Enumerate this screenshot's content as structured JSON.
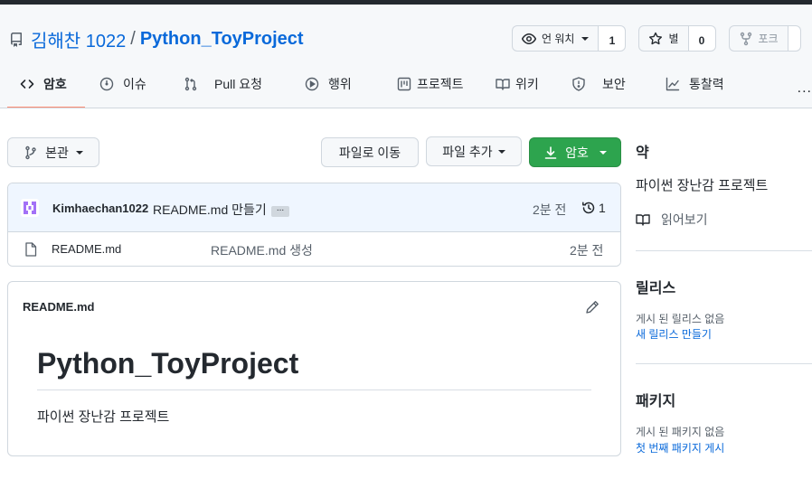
{
  "repo": {
    "owner": "김해찬 1022",
    "separator": "/",
    "name": "Python_ToyProject"
  },
  "actions": {
    "watch": {
      "label": "언 워치",
      "count": "1"
    },
    "star": {
      "label": "별",
      "count": "0"
    },
    "fork": {
      "label": "포크"
    }
  },
  "tabs": [
    {
      "label": "암호",
      "icon": "code-icon"
    },
    {
      "label": "이슈",
      "icon": "issue-icon"
    },
    {
      "label": "Pull 요청",
      "icon": "pull-request-icon"
    },
    {
      "label": "행위",
      "icon": "play-icon"
    },
    {
      "label": "프로젝트",
      "icon": "project-icon"
    },
    {
      "label": "위키",
      "icon": "book-icon"
    },
    {
      "label": "보안",
      "icon": "shield-icon"
    },
    {
      "label": "통찰력",
      "icon": "graph-icon"
    }
  ],
  "more_label": "...",
  "toolbar": {
    "branch_label": "본관",
    "goto_file_label": "파일로 이동",
    "add_file_label": "파일 추가",
    "code_label": "암호"
  },
  "commit": {
    "author": "Kimhaechan1022",
    "message": "README.md 만들기",
    "ellipsis": "...",
    "time": "2분 전",
    "history_count": "1"
  },
  "files": [
    {
      "name": "README.md",
      "message": "README.md 생성",
      "time": "2분 전"
    }
  ],
  "readme": {
    "header": "README.md",
    "title": "Python_ToyProject",
    "body": "파이썬 장난감 프로젝트"
  },
  "sidebar": {
    "about_title": "약",
    "description": "파이썬 장난감 프로젝트",
    "readme_link": "읽어보기",
    "releases_title": "릴리스",
    "releases_empty": "게시 된 릴리스 없음",
    "releases_create": "새 릴리스 만들기",
    "packages_title": "패키지",
    "packages_empty": "게시 된 패키지 없음",
    "packages_create": "첫 번째 패키지 게시"
  },
  "colors": {
    "primary_link": "#0969da",
    "tab_underline": "#fd8c73",
    "code_button": "#2da44e",
    "commit_row_bg": "#eff6ff",
    "avatar": "#a371f7"
  }
}
